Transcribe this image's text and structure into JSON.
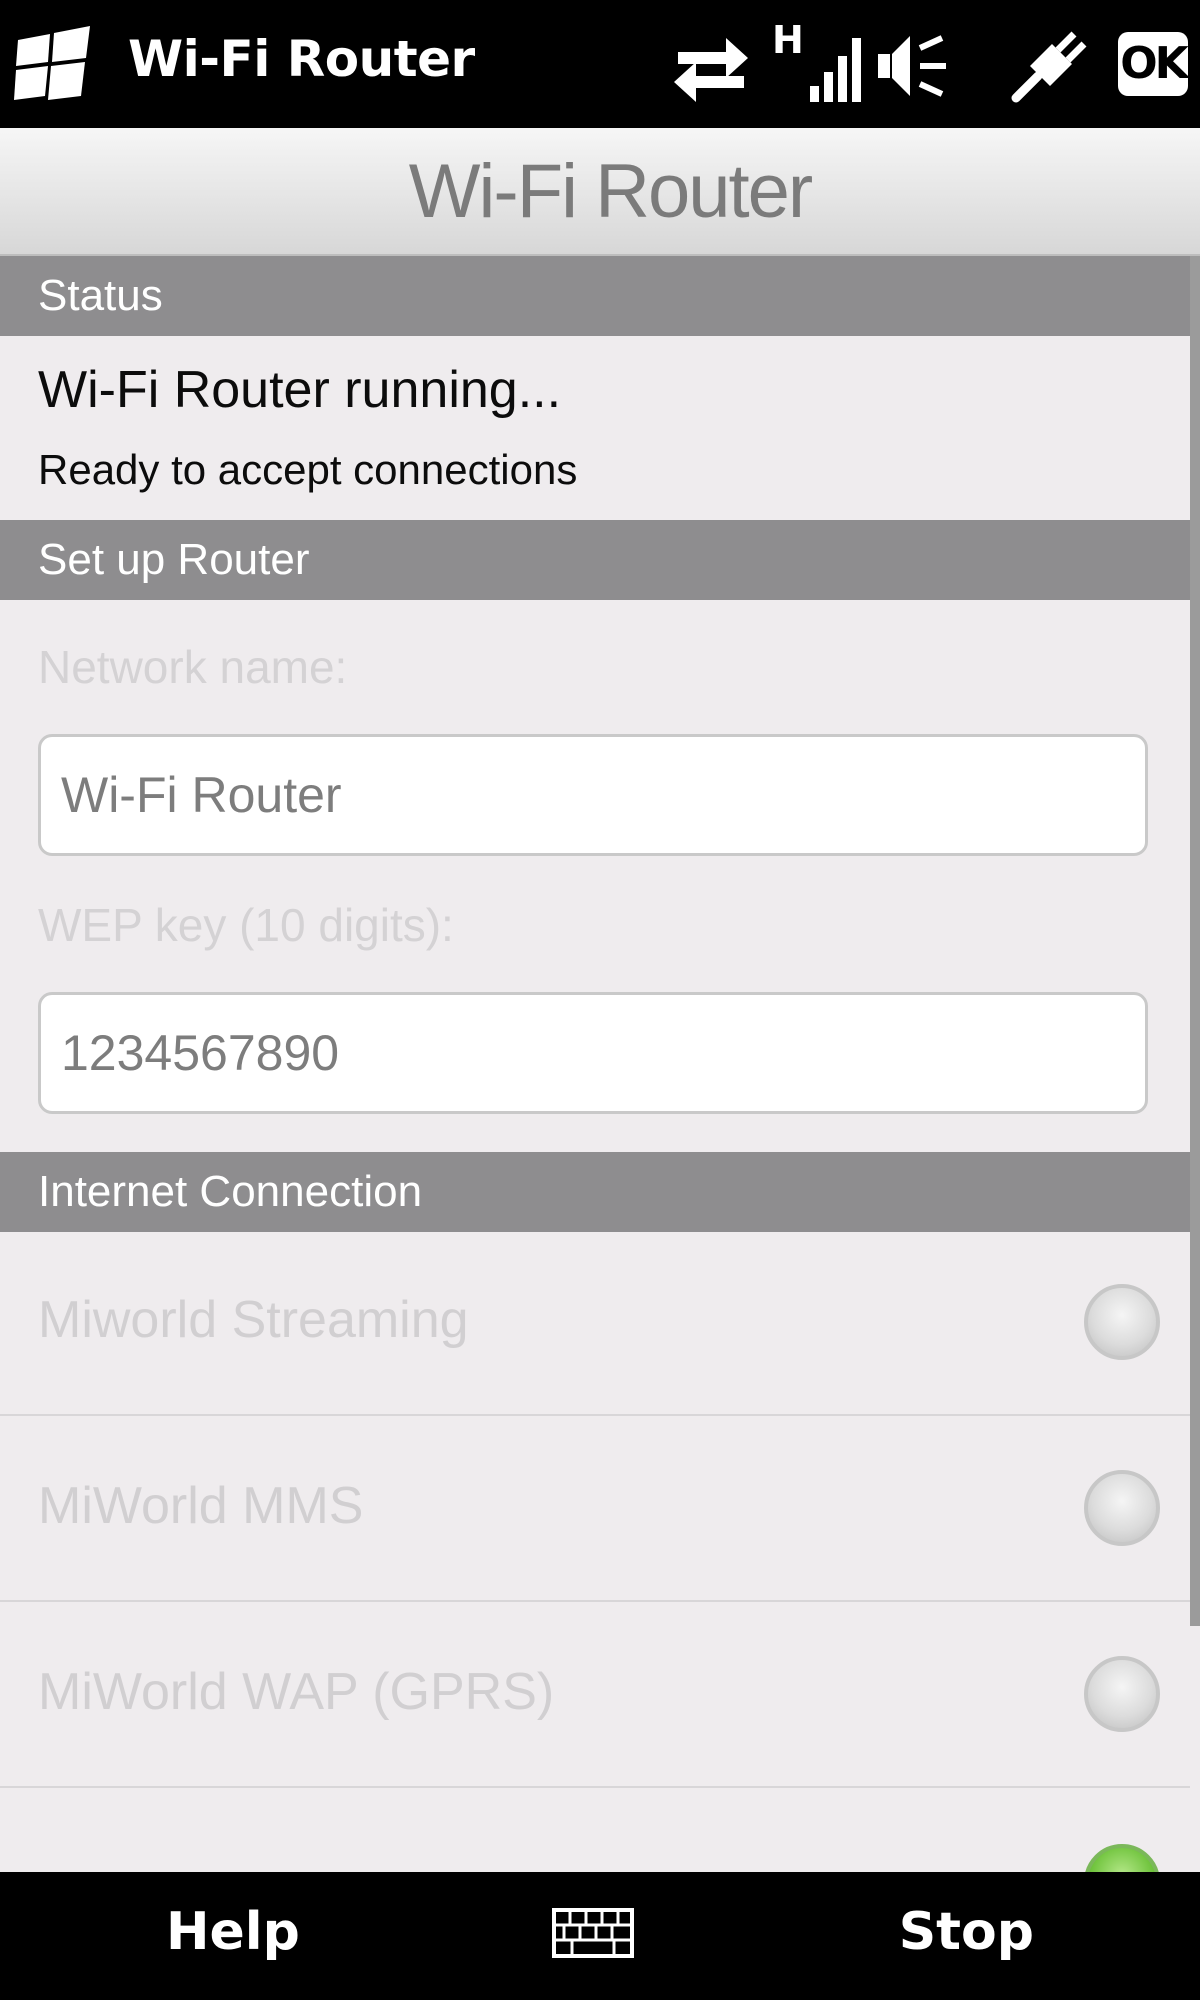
{
  "status_bar": {
    "app_title": "Wi-Fi Router",
    "ok_label": "OK",
    "icons": [
      "windows-start-icon",
      "data-transfer-icon",
      "hsdpa-indicator-icon",
      "signal-strength-icon",
      "speaker-muted-icon",
      "usb-connection-icon"
    ],
    "network_type": "H"
  },
  "header": {
    "title": "Wi-Fi Router"
  },
  "status_section": {
    "header": "Status",
    "main_text": "Wi-Fi Router running...",
    "sub_text": "Ready to accept connections"
  },
  "setup_section": {
    "header": "Set up Router",
    "network_name_label": "Network name:",
    "network_name_value": "Wi-Fi Router",
    "wep_key_label": "WEP key (10 digits):",
    "wep_key_value": "1234567890"
  },
  "internet_section": {
    "header": "Internet Connection",
    "items": [
      {
        "label": "Miworld Streaming",
        "selected": false
      },
      {
        "label": "MiWorld MMS",
        "selected": false
      },
      {
        "label": "MiWorld WAP (GPRS)",
        "selected": false
      }
    ]
  },
  "soft_keys": {
    "left": "Help",
    "right": "Stop",
    "center_icon": "keyboard-icon"
  },
  "colors": {
    "section_header": "#8e8d8f",
    "background": "#efecee",
    "selected_radio": "#6dc23a"
  }
}
